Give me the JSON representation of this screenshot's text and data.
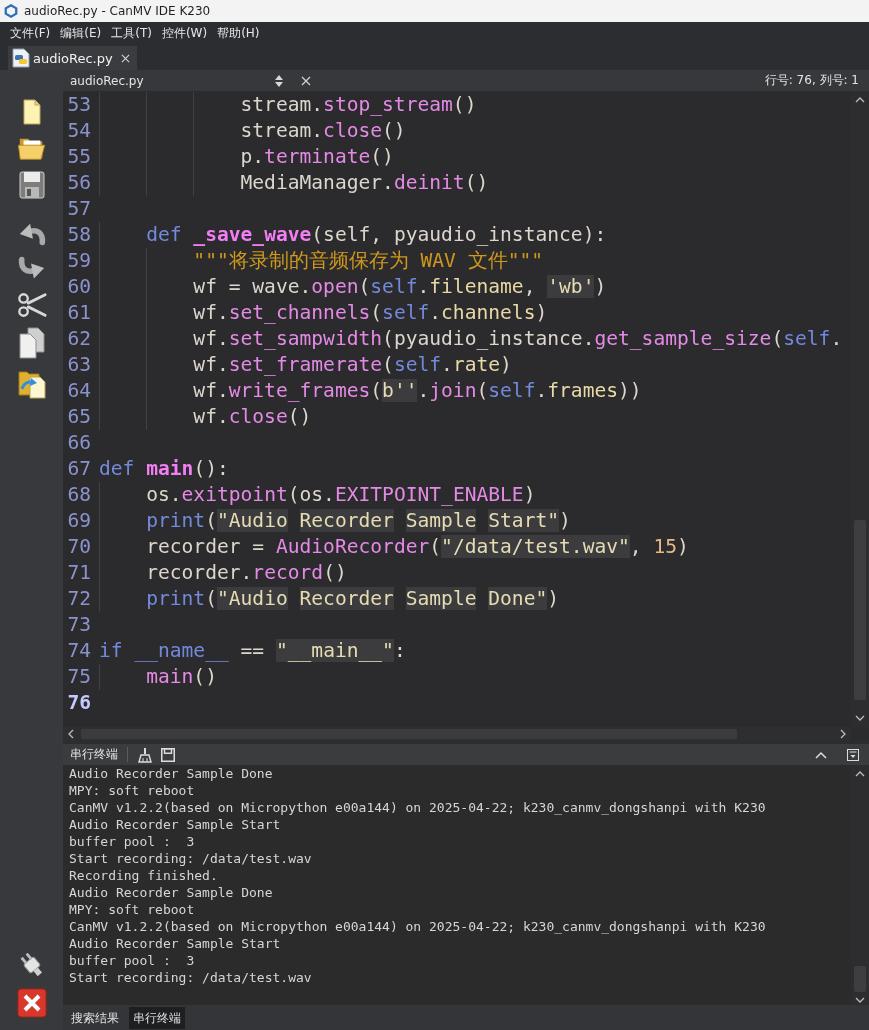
{
  "window": {
    "title": "audioRec.py - CanMV IDE K230"
  },
  "menu": [
    "文件(F)",
    "编辑(E)",
    "工具(T)",
    "控件(W)",
    "帮助(H)"
  ],
  "file_tabs": [
    {
      "label": "audioRec.py",
      "selected": true
    }
  ],
  "editor": {
    "file_name": "audioRec.py",
    "position": "行号: 76, 列号: 1",
    "lines": [
      {
        "number": "53",
        "current": false,
        "tokens": [
          {
            "text": "            stream.",
            "kind": "plain"
          },
          {
            "text": "stop_stream",
            "kind": "call"
          },
          {
            "text": "()",
            "kind": "plain"
          }
        ]
      },
      {
        "number": "54",
        "current": false,
        "tokens": [
          {
            "text": "            stream.",
            "kind": "plain"
          },
          {
            "text": "close",
            "kind": "call"
          },
          {
            "text": "()",
            "kind": "plain"
          }
        ]
      },
      {
        "number": "55",
        "current": false,
        "tokens": [
          {
            "text": "            p.",
            "kind": "plain"
          },
          {
            "text": "terminate",
            "kind": "call"
          },
          {
            "text": "()",
            "kind": "plain"
          }
        ]
      },
      {
        "number": "56",
        "current": false,
        "tokens": [
          {
            "text": "            MediaManager.",
            "kind": "plain"
          },
          {
            "text": "deinit",
            "kind": "call"
          },
          {
            "text": "()",
            "kind": "plain"
          }
        ]
      },
      {
        "number": "57",
        "current": false
      },
      {
        "number": "58",
        "current": false,
        "tokens": [
          {
            "text": "    def",
            "kind": "keyword"
          },
          {
            "text": " _save_wave",
            "kind": "defname"
          },
          {
            "text": "(self, pyaudio_instance):",
            "kind": "plain"
          }
        ]
      },
      {
        "number": "59",
        "current": false,
        "tokens": [
          {
            "text": "        \"\"\"将录制的音频保存为 WAV 文件\"\"\"",
            "kind": "docstring"
          }
        ]
      },
      {
        "number": "60",
        "current": false,
        "tokens": [
          {
            "text": "        wf = wave.",
            "kind": "plain"
          },
          {
            "text": "open",
            "kind": "call"
          },
          {
            "text": "(",
            "kind": "plain"
          },
          {
            "text": "self",
            "kind": "keyword"
          },
          {
            "text": ".",
            "kind": "plain"
          },
          {
            "text": "filename",
            "kind": "attr"
          },
          {
            "text": ", ",
            "kind": "plain"
          },
          {
            "text": "'wb'",
            "kind": "string"
          },
          {
            "text": ")",
            "kind": "plain"
          }
        ]
      },
      {
        "number": "61",
        "current": false,
        "tokens": [
          {
            "text": "        wf.",
            "kind": "plain"
          },
          {
            "text": "set_channels",
            "kind": "call"
          },
          {
            "text": "(",
            "kind": "plain"
          },
          {
            "text": "self",
            "kind": "keyword"
          },
          {
            "text": ".",
            "kind": "plain"
          },
          {
            "text": "channels",
            "kind": "attr"
          },
          {
            "text": ")",
            "kind": "plain"
          }
        ]
      },
      {
        "number": "62",
        "current": false,
        "tokens": [
          {
            "text": "        wf.",
            "kind": "plain"
          },
          {
            "text": "set_sampwidth",
            "kind": "call"
          },
          {
            "text": "(pyaudio_instance.",
            "kind": "plain"
          },
          {
            "text": "get_sample_size",
            "kind": "call"
          },
          {
            "text": "(",
            "kind": "plain"
          },
          {
            "text": "self",
            "kind": "keyword"
          },
          {
            "text": ".",
            "kind": "plain"
          }
        ]
      },
      {
        "number": "63",
        "current": false,
        "tokens": [
          {
            "text": "        wf.",
            "kind": "plain"
          },
          {
            "text": "set_framerate",
            "kind": "call"
          },
          {
            "text": "(",
            "kind": "plain"
          },
          {
            "text": "self",
            "kind": "keyword"
          },
          {
            "text": ".",
            "kind": "plain"
          },
          {
            "text": "rate",
            "kind": "attr"
          },
          {
            "text": ")",
            "kind": "plain"
          }
        ]
      },
      {
        "number": "64",
        "current": false,
        "tokens": [
          {
            "text": "        wf.",
            "kind": "plain"
          },
          {
            "text": "write_frames",
            "kind": "call"
          },
          {
            "text": "(",
            "kind": "plain"
          },
          {
            "text": "b''",
            "kind": "string"
          },
          {
            "text": ".",
            "kind": "plain"
          },
          {
            "text": "join",
            "kind": "call"
          },
          {
            "text": "(",
            "kind": "plain"
          },
          {
            "text": "self",
            "kind": "keyword"
          },
          {
            "text": ".",
            "kind": "plain"
          },
          {
            "text": "frames",
            "kind": "attr"
          },
          {
            "text": "))",
            "kind": "plain"
          }
        ]
      },
      {
        "number": "65",
        "current": false,
        "tokens": [
          {
            "text": "        wf.",
            "kind": "plain"
          },
          {
            "text": "close",
            "kind": "call"
          },
          {
            "text": "()",
            "kind": "plain"
          }
        ]
      },
      {
        "number": "66",
        "current": false
      },
      {
        "number": "67",
        "current": false,
        "tokens": [
          {
            "text": "def",
            "kind": "keyword"
          },
          {
            "text": " main",
            "kind": "defname"
          },
          {
            "text": "():",
            "kind": "plain"
          }
        ]
      },
      {
        "number": "68",
        "current": false,
        "tokens": [
          {
            "text": "    os.",
            "kind": "plain"
          },
          {
            "text": "exitpoint",
            "kind": "call"
          },
          {
            "text": "(os.",
            "kind": "plain"
          },
          {
            "text": "EXITPOINT_ENABLE",
            "kind": "call"
          },
          {
            "text": ")",
            "kind": "plain"
          }
        ]
      },
      {
        "number": "69",
        "current": false,
        "tokens": [
          {
            "text": "    print",
            "kind": "keyword"
          },
          {
            "text": "(",
            "kind": "plain"
          },
          {
            "text": "\"Audio Recorder Sample Start\"",
            "kind": "string"
          },
          {
            "text": ")",
            "kind": "plain"
          }
        ]
      },
      {
        "number": "70",
        "current": false,
        "tokens": [
          {
            "text": "    recorder = ",
            "kind": "plain"
          },
          {
            "text": "AudioRecorder",
            "kind": "call"
          },
          {
            "text": "(",
            "kind": "plain"
          },
          {
            "text": "\"/data/test.wav\"",
            "kind": "string"
          },
          {
            "text": ", ",
            "kind": "plain"
          },
          {
            "text": "15",
            "kind": "number"
          },
          {
            "text": ")",
            "kind": "plain"
          }
        ]
      },
      {
        "number": "71",
        "current": false,
        "tokens": [
          {
            "text": "    recorder.",
            "kind": "plain"
          },
          {
            "text": "record",
            "kind": "call"
          },
          {
            "text": "()",
            "kind": "plain"
          }
        ]
      },
      {
        "number": "72",
        "current": false,
        "tokens": [
          {
            "text": "    print",
            "kind": "keyword"
          },
          {
            "text": "(",
            "kind": "plain"
          },
          {
            "text": "\"Audio Recorder Sample Done\"",
            "kind": "string"
          },
          {
            "text": ")",
            "kind": "plain"
          }
        ]
      },
      {
        "number": "73",
        "current": false
      },
      {
        "number": "74",
        "current": false,
        "tokens": [
          {
            "text": "if",
            "kind": "keyword"
          },
          {
            "text": " __name__",
            "kind": "keyword"
          },
          {
            "text": " == ",
            "kind": "plain"
          },
          {
            "text": "\"__main__\"",
            "kind": "string"
          },
          {
            "text": ":",
            "kind": "plain"
          }
        ]
      },
      {
        "number": "75",
        "current": false,
        "tokens": [
          {
            "text": "    main",
            "kind": "call"
          },
          {
            "text": "()",
            "kind": "plain"
          }
        ]
      },
      {
        "number": "76",
        "current": true
      }
    ]
  },
  "terminal": {
    "title": "串行终端",
    "lines": [
      "Audio Recorder Sample Done",
      "MPY: soft reboot",
      "CanMV v1.2.2(based on Micropython e00a144) on 2025-04-22; k230_canmv_dongshanpi with K230",
      "Audio Recorder Sample Start",
      "buffer pool :  3",
      "Start recording: /data/test.wav",
      "Recording finished.",
      "Audio Recorder Sample Done",
      "MPY: soft reboot",
      "CanMV v1.2.2(based on Micropython e00a144) on 2025-04-22; k230_canmv_dongshanpi with K230",
      "Audio Recorder Sample Start",
      "buffer pool :  3",
      "Start recording: /data/test.wav"
    ]
  },
  "bottom_tabs": [
    {
      "label": "搜索结果",
      "selected": false
    },
    {
      "label": "串行终端",
      "selected": true
    }
  ]
}
